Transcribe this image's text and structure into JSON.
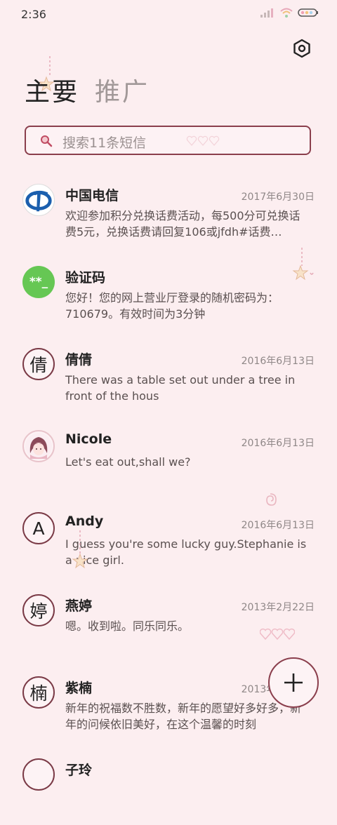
{
  "status": {
    "time": "2:36"
  },
  "tabs": [
    {
      "label": "主要"
    },
    {
      "label": "推广"
    }
  ],
  "search": {
    "placeholder": "搜索11条短信"
  },
  "messages": [
    {
      "name": "中国电信",
      "date": "2017年6月30日",
      "preview": "欢迎参加积分兑换话费活动，每500分可兑换话费5元，兑换话费请回复106或jfdh#话费…"
    },
    {
      "name": "验证码",
      "date": "",
      "avatar_text": "**_",
      "preview": "您好！您的网上营业厅登录的随机密码为：710679。有效时间为3分钟"
    },
    {
      "name": "倩倩",
      "date": "2016年6月13日",
      "avatar_text": "倩",
      "preview": "There was a table set out under a tree in front of the hous"
    },
    {
      "name": "Nicole",
      "date": "2016年6月13日",
      "preview": "Let's eat out,shall we?"
    },
    {
      "name": "Andy",
      "date": "2016年6月13日",
      "avatar_text": "A",
      "preview": "I guess you're some lucky guy.Stephanie is a nice girl."
    },
    {
      "name": "燕婷",
      "date": "2013年2月22日",
      "avatar_text": "婷",
      "preview": "嗯。收到啦。同乐同乐。"
    },
    {
      "name": "紫楠",
      "date": "2013年2月22日",
      "avatar_text": "楠",
      "preview": "新年的祝福数不胜数，新年的愿望好多好多，新年的问候依旧美好，在这个温馨的时刻"
    },
    {
      "name": "子玲",
      "date": "",
      "avatar_text": ""
    }
  ],
  "icons": {
    "settings": "settings-hexagon-icon",
    "search": "search-icon",
    "fab": "plus-icon"
  },
  "colors": {
    "background": "#fceef0",
    "accent": "#8a3e4c",
    "green_avatar": "#66c754",
    "telecom_blue": "#1b5fae"
  }
}
